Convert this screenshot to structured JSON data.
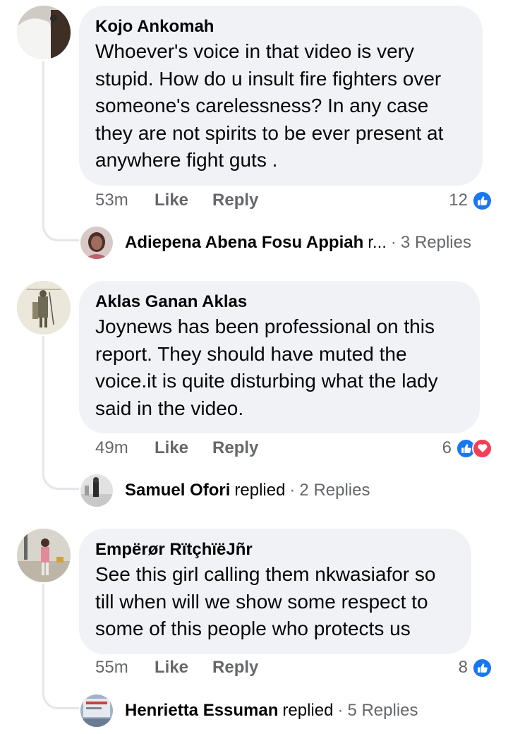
{
  "comments": [
    {
      "author": "Kojo Ankomah",
      "text": "Whoever's voice in that video is very stupid. How do u insult fire fighters over someone's carelessness? In any case they are not spirits to be ever present at anywhere fight guts .",
      "time": "53m",
      "like_label": "Like",
      "reply_label": "Reply",
      "reaction_count": "12",
      "reactions": [
        "like-icon"
      ],
      "reply_preview": {
        "name": "Adiepena Abena Fosu Appiah",
        "verb": "r...",
        "separator": "·",
        "count": "3 Replies"
      }
    },
    {
      "author": "Aklas Ganan Aklas",
      "text": "Joynews has been professional on this report. They should have muted the voice.it is quite disturbing what the lady said in the video.",
      "time": "49m",
      "like_label": "Like",
      "reply_label": "Reply",
      "reaction_count": "6",
      "reactions": [
        "like-icon",
        "love-icon"
      ],
      "reply_preview": {
        "name": "Samuel Ofori",
        "verb": "replied",
        "separator": "·",
        "count": "2 Replies"
      }
    },
    {
      "author": "Empërør RïtçhïëJñr",
      "text": "See this girl calling them nkwasiafor so till when will we show some respect to some of this people who protects us",
      "time": "55m",
      "like_label": "Like",
      "reply_label": "Reply",
      "reaction_count": "8",
      "reactions": [
        "like-icon"
      ],
      "reply_preview": {
        "name": "Henrietta Essuman",
        "verb": "replied",
        "separator": "·",
        "count": "5 Replies"
      }
    }
  ],
  "colors": {
    "like": "#1877f2",
    "love": "#f33e58",
    "bubble": "#f0f2f5",
    "secondary_text": "#65676b"
  }
}
